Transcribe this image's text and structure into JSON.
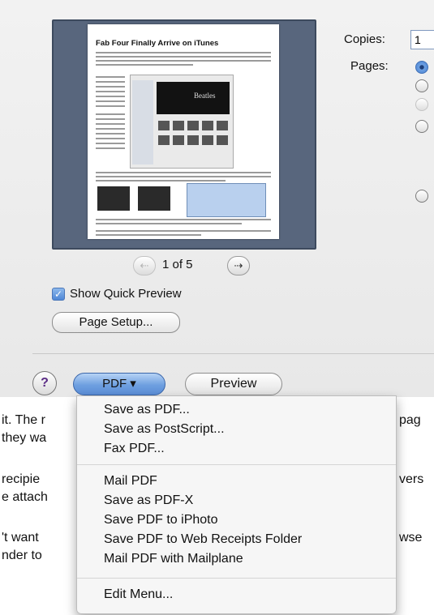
{
  "dialog": {
    "preview": {
      "doc_title": "Fab Four Finally Arrive on iTunes",
      "screenshot_caption": "Beatles"
    },
    "pagination": {
      "text": "1 of 5",
      "prev_icon": "left-arrow-icon",
      "next_icon": "right-arrow-icon"
    },
    "quick_preview": {
      "label": "Show Quick Preview",
      "checked": true
    },
    "page_setup_label": "Page Setup...",
    "copies": {
      "label": "Copies:",
      "value": "1"
    },
    "pages_label": "Pages:",
    "help_label": "?",
    "pdf_button_label": "PDF ▾",
    "preview_button_label": "Preview"
  },
  "background_text": [
    "it. The r",
    "pag",
    "they wa",
    "recipie",
    "vers",
    "e attach",
    "'t want",
    "wse",
    "nder to"
  ],
  "pdf_menu": {
    "group1": [
      "Save as PDF...",
      "Save as PostScript...",
      "Fax PDF..."
    ],
    "group2": [
      "Mail PDF",
      "Save as PDF-X",
      "Save PDF to iPhoto",
      "Save PDF to Web Receipts Folder",
      "Mail PDF with Mailplane"
    ],
    "group3": [
      "Edit Menu..."
    ]
  },
  "colors": {
    "accent": "#5c8fd8",
    "preview_bg": "#58667d"
  }
}
